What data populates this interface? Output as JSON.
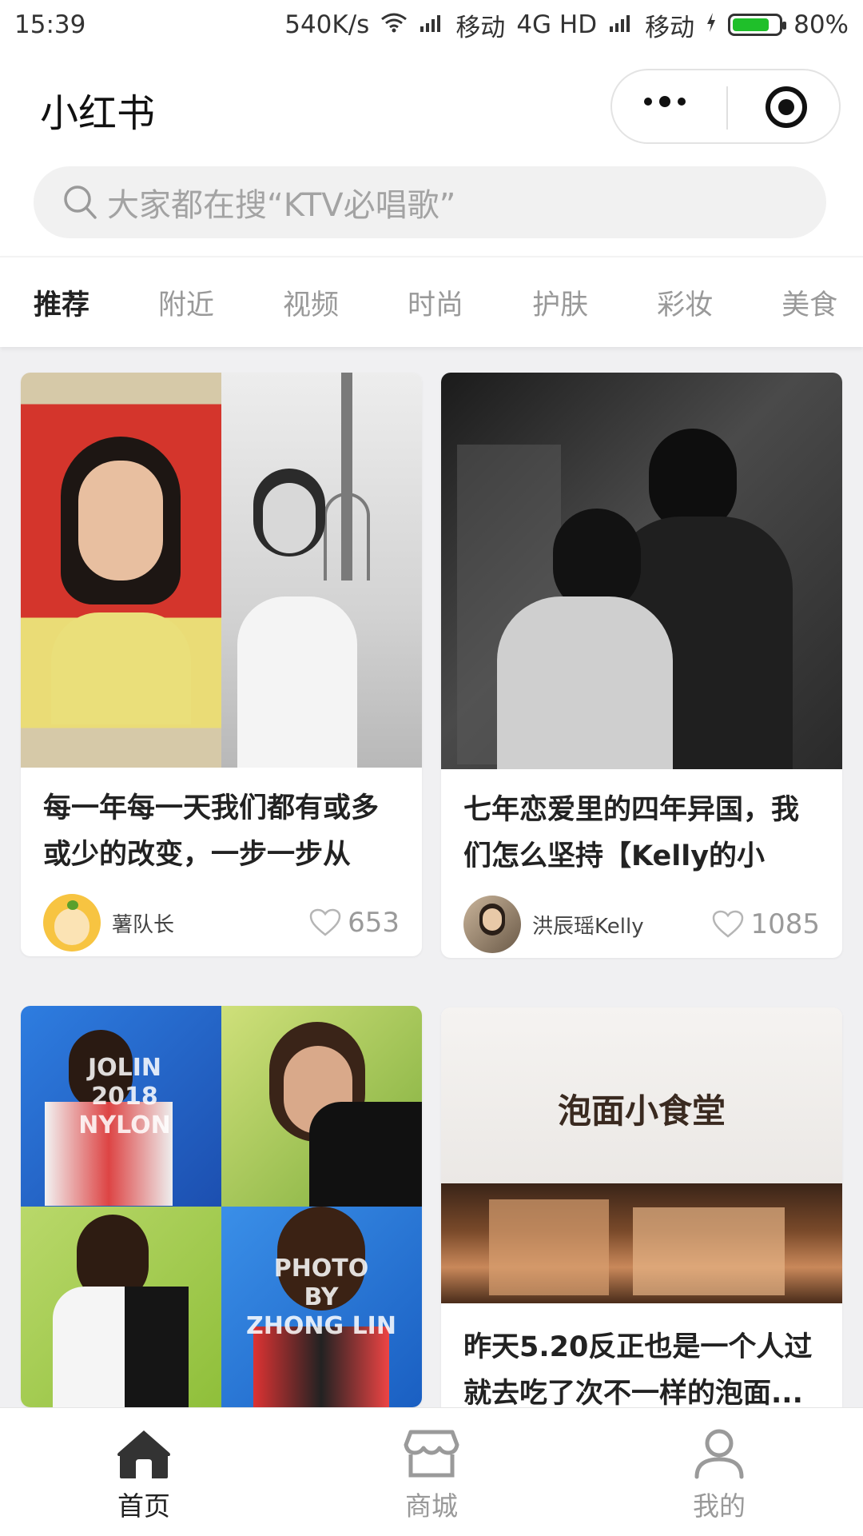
{
  "status_bar": {
    "time": "15:39",
    "speed": "540K/s",
    "carrier1": "移动",
    "network": "4G HD",
    "carrier2": "移动",
    "battery": "80%",
    "battery_level": 0.8,
    "battery_color": "#1fbf2a"
  },
  "header": {
    "title": "小红书"
  },
  "search": {
    "placeholder": "大家都在搜“KTV必唱歌”"
  },
  "tabs": [
    {
      "label": "推荐",
      "active": true
    },
    {
      "label": "附近"
    },
    {
      "label": "视频"
    },
    {
      "label": "时尚"
    },
    {
      "label": "护肤"
    },
    {
      "label": "彩妆"
    },
    {
      "label": "美食"
    }
  ],
  "cards": [
    {
      "title": "每一年每一天我们都有或多或少的改变，一步一步从学..",
      "author": "薯队长",
      "likes": "653"
    },
    {
      "title": "七年恋爱里的四年异国，我们怎么坚持【Kelly的小星...",
      "author": "洪辰瑶Kelly",
      "likes": "1085"
    },
    {
      "image_text_top": "JOLIN\n2018\nNYLON",
      "image_text_bottom": "PHOTO\nBY\nZHONG LIN"
    },
    {
      "image_sign": "泡面小食堂",
      "title": "昨天5.20反正也是一个人过就去吃了次不一样的泡面..."
    }
  ],
  "bottom_nav": [
    {
      "label": "首页",
      "icon": "home-icon",
      "active": true
    },
    {
      "label": "商城",
      "icon": "store-icon"
    },
    {
      "label": "我的",
      "icon": "profile-icon"
    }
  ]
}
